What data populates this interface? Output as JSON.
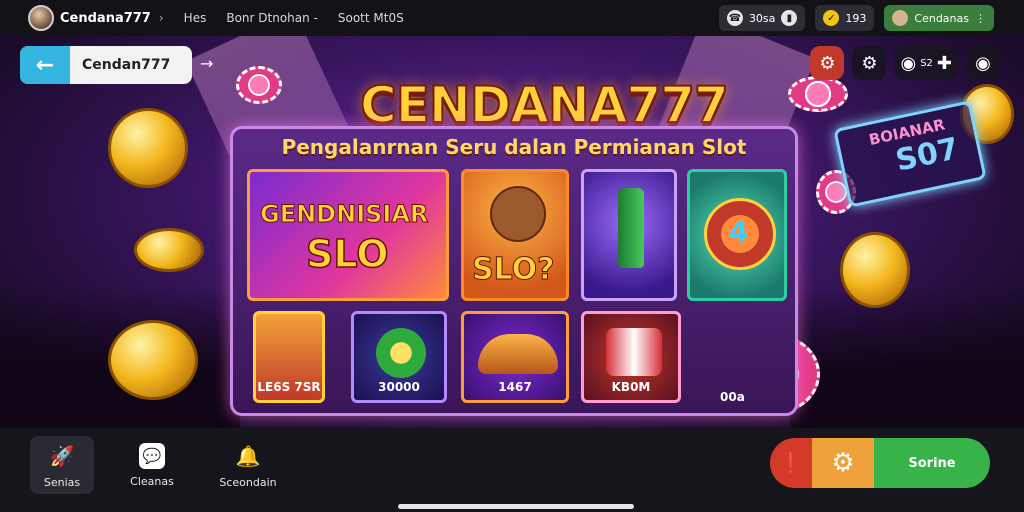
{
  "topbar": {
    "brand": "Cendana777",
    "sep": "›",
    "nav": [
      "Hes",
      "Bonr Dtnohan -",
      "Soott Mt0S"
    ],
    "phone_label": "30sa",
    "wallet_amount": "193",
    "user_name": "Cendanas"
  },
  "header": {
    "back_name": "Cendan777",
    "back_arrow": "←",
    "forward_arrow": "→",
    "title": "CENDANA777",
    "subtitle": "Pengalanrnan Seru dalan Permianan Slot",
    "icon_badge": "S2"
  },
  "sign": {
    "line1": "BOIANAR",
    "line2": "S07"
  },
  "tiles": {
    "big_line1": "GENDNISIAR",
    "big_line2": "SLO",
    "dog_text": "SLO?",
    "chip_symbol": "4"
  },
  "small_tiles": [
    {
      "label": "LE6S 7SR"
    },
    {
      "label": "30000"
    },
    {
      "label": "1467"
    },
    {
      "label": "KB0M"
    }
  ],
  "side_label": "00a",
  "bottom_nav": [
    {
      "label": "Senias",
      "active": true
    },
    {
      "label": "Cleanas",
      "active": false
    },
    {
      "label": "Sceondain",
      "active": false
    }
  ],
  "cta": {
    "label": "Sorine"
  },
  "colors": {
    "accent_blue": "#35b6e0",
    "cta_green": "#37b34a",
    "cta_orange": "#f0a23a",
    "cta_red": "#d33a2a",
    "title_gold": "#ffd23a"
  }
}
